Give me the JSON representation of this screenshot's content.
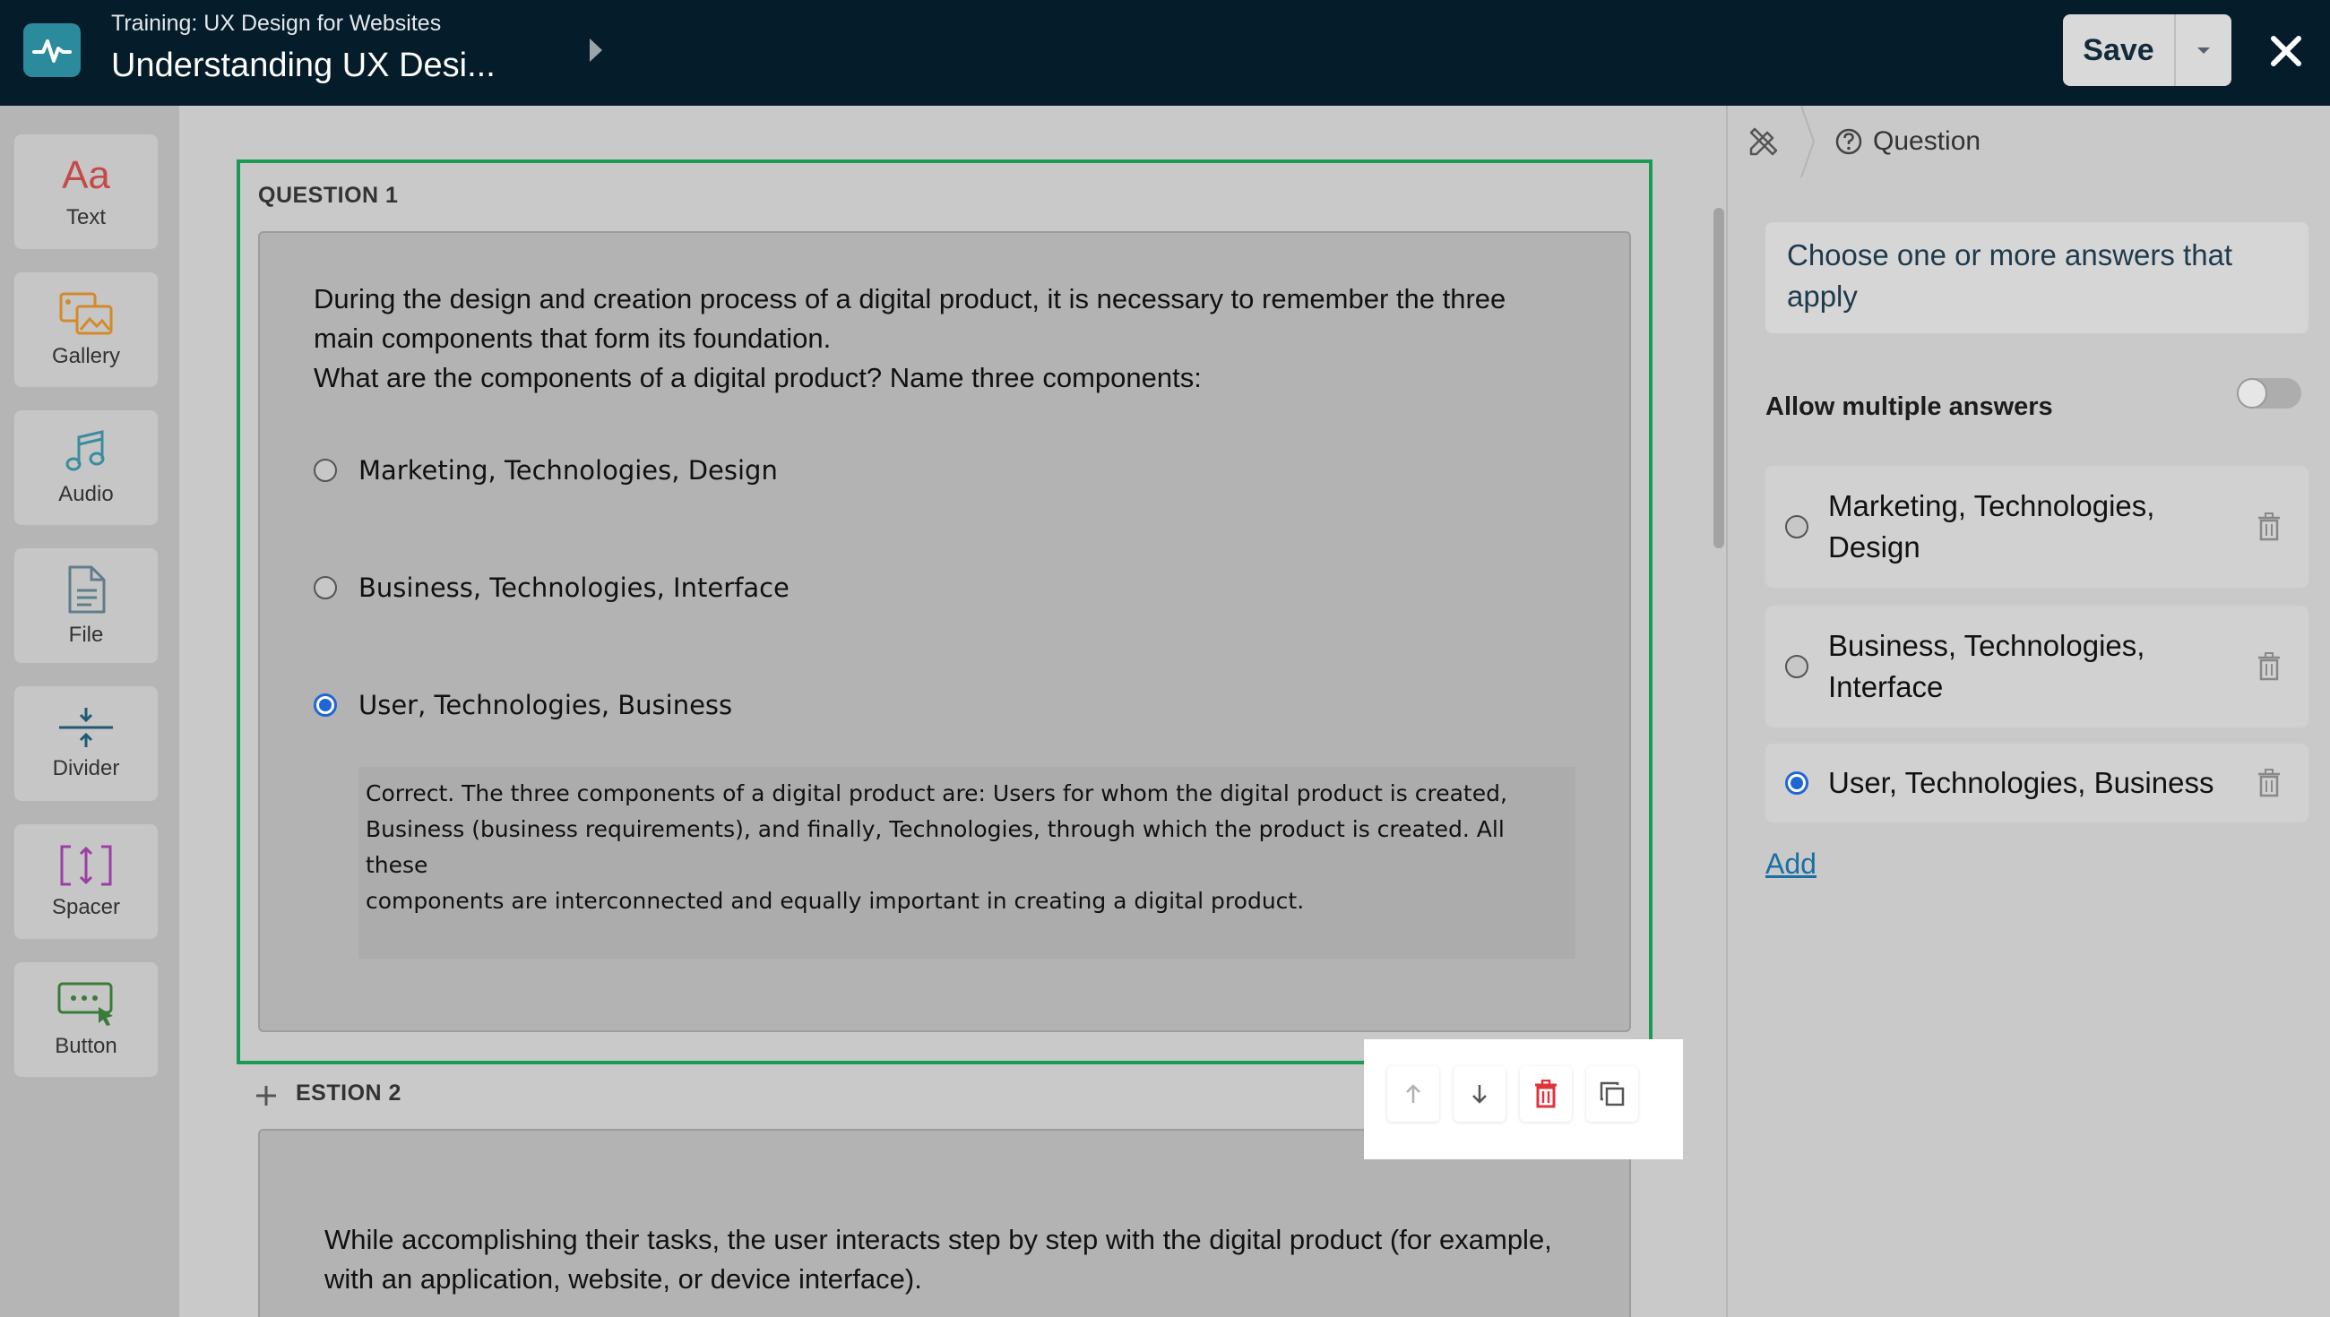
{
  "header": {
    "course_title": "Training: UX Design for Websites",
    "lesson_title": "Understanding UX Desi...",
    "save_label": "Save"
  },
  "toolbar": {
    "items": [
      {
        "label": "Text",
        "icon": "text-icon"
      },
      {
        "label": "Gallery",
        "icon": "gallery-icon"
      },
      {
        "label": "Audio",
        "icon": "audio-icon"
      },
      {
        "label": "File",
        "icon": "file-icon"
      },
      {
        "label": "Divider",
        "icon": "divider-icon"
      },
      {
        "label": "Spacer",
        "icon": "spacer-icon"
      },
      {
        "label": "Button",
        "icon": "button-icon"
      }
    ],
    "text_glyph": "Aa"
  },
  "canvas": {
    "question1": {
      "label": "QUESTION 1",
      "text_line1": "During the design and creation process of a digital product, it is necessary to remember the three",
      "text_line2": "main components that form its foundation.",
      "text_line3": "What are the components of a digital product? Name three components:",
      "options": [
        {
          "label": "Marketing, Technologies, Design",
          "selected": false
        },
        {
          "label": "Business, Technologies, Interface",
          "selected": false
        },
        {
          "label": "User, Technologies, Business",
          "selected": true
        }
      ],
      "feedback_line1": "Correct. The three components of a digital product are: Users for whom the digital product is created,",
      "feedback_line2": "Business (business requirements), and finally, Technologies, through which the product is created. All these",
      "feedback_line3": "components are interconnected and equally important in creating a digital product."
    },
    "question2": {
      "label_visible": "ESTION 2",
      "text_line1": "While accomplishing their tasks, the user interacts step by step with the digital product (for example,",
      "text_line2": "with an application, website, or device interface)."
    }
  },
  "right_panel": {
    "breadcrumb_label": "Question",
    "instruction": "Choose one or more answers that apply",
    "allow_multiple_label": "Allow multiple answers",
    "allow_multiple_enabled": false,
    "answers": [
      {
        "label": "Marketing, Technologies, Design",
        "selected": false
      },
      {
        "label": "Business, Technologies, Interface",
        "selected": false
      },
      {
        "label": "User, Technologies, Business",
        "selected": true
      }
    ],
    "add_label": "Add"
  },
  "colors": {
    "header_bg": "#051c2a",
    "accent_green": "#1b9a54",
    "radio_blue": "#1f66d4",
    "delete_red": "#e0343c",
    "link_blue": "#1a6fa3"
  }
}
